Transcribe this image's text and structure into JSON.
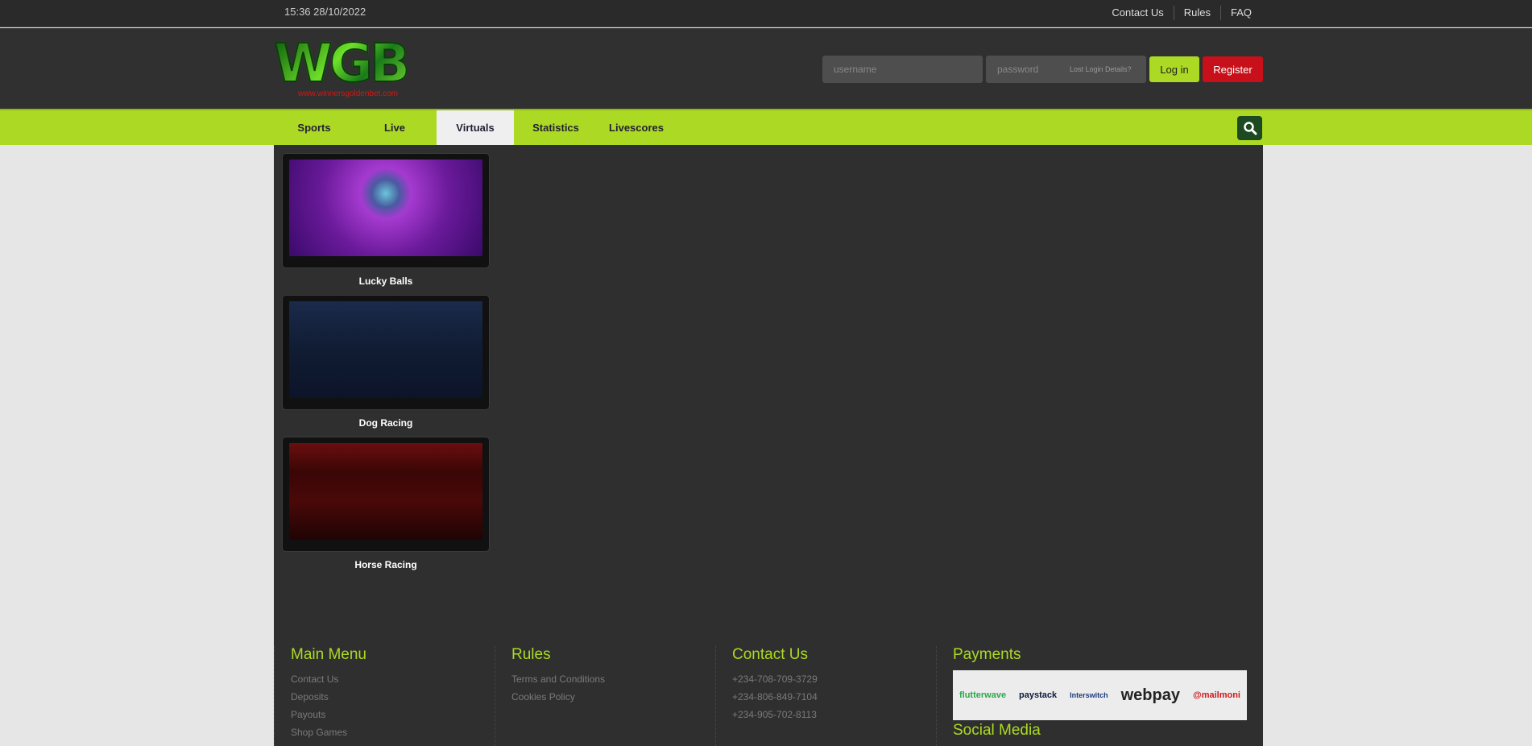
{
  "topbar": {
    "datetime": "15:36 28/10/2022",
    "links": [
      "Contact Us",
      "Rules",
      "FAQ"
    ]
  },
  "header": {
    "logo_text": "WGB",
    "logo_url": "www.winnersgoldenbet.com",
    "username_placeholder": "username",
    "password_placeholder": "password",
    "lost_login": "Lost Login Details?",
    "login": "Log in",
    "register": "Register"
  },
  "nav": {
    "items": [
      "Sports",
      "Live",
      "Virtuals",
      "Statistics",
      "Livescores"
    ],
    "active": "Virtuals",
    "search_icon": "search-icon"
  },
  "games": [
    {
      "name": "Lucky Balls"
    },
    {
      "name": "Dog Racing"
    },
    {
      "name": "Horse Racing"
    }
  ],
  "footer": {
    "main_menu": {
      "title": "Main Menu",
      "items": [
        "Contact Us",
        "Deposits",
        "Payouts",
        "Shop Games"
      ]
    },
    "rules": {
      "title": "Rules",
      "items": [
        "Terms and Conditions",
        "Cookies Policy"
      ]
    },
    "contact": {
      "title": "Contact Us",
      "items": [
        "+234-708-709-3729",
        "+234-806-849-7104",
        "+234-905-702-8113"
      ]
    },
    "payments": {
      "title": "Payments",
      "logos": [
        "flutterwave",
        "paystack",
        "Interswitch",
        "webpay",
        "@mailmoni"
      ]
    },
    "social": {
      "title": "Social Media"
    }
  },
  "colors": {
    "accent": "#acd923",
    "register": "#c8101a",
    "panel": "#2f2f2f"
  }
}
